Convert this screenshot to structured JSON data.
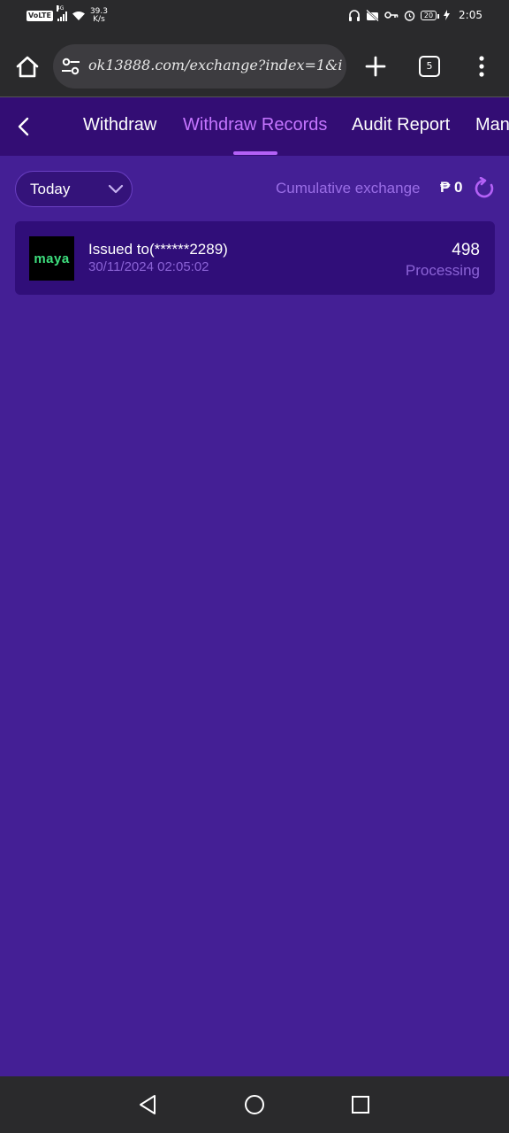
{
  "status_bar": {
    "volte": "VoLTE",
    "network": "4G",
    "speed_value": "39.3",
    "speed_unit": "K/s",
    "battery": "20",
    "time": "2:05",
    "icons": [
      "headphones-icon",
      "camera-off-icon",
      "vpn-key-icon",
      "alarm-icon",
      "battery-icon",
      "charging-icon"
    ]
  },
  "browser": {
    "url": "ok13888.com/exchange?index=1&i",
    "tab_count": "5",
    "icons": [
      "home-icon",
      "site-settings-icon",
      "new-tab-plus-icon",
      "tab-switcher-icon",
      "menu-dots-icon"
    ]
  },
  "app_nav": {
    "tabs": [
      {
        "label": "Withdraw",
        "active": false
      },
      {
        "label": "Withdraw Records",
        "active": true
      },
      {
        "label": "Audit Report",
        "active": false
      },
      {
        "label": "Man",
        "active": false
      }
    ]
  },
  "filter": {
    "selected": "Today",
    "cumulative_label": "Cumulative exchange",
    "cumulative_value": "₱ 0"
  },
  "records": [
    {
      "logo_text": "maya",
      "title": "Issued to(******2289)",
      "datetime": "30/11/2024 02:05:02",
      "amount": "498",
      "status": "Processing"
    }
  ],
  "colors": {
    "background": "#441f95",
    "nav_background": "#330d74",
    "active_tab": "#c575ff",
    "card": "#300e79",
    "muted_text": "#8b63d6",
    "maya_green": "#3ee07e"
  }
}
